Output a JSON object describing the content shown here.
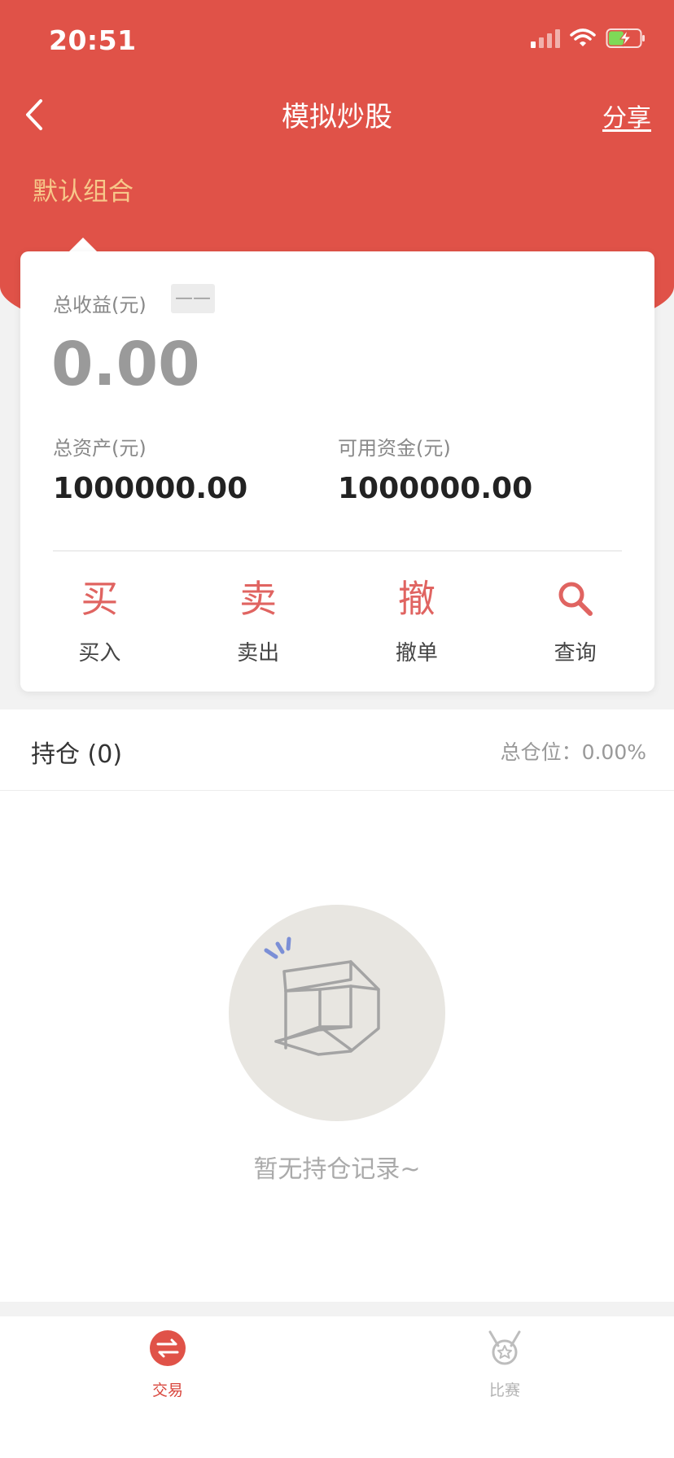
{
  "status_bar": {
    "time": "20:51"
  },
  "nav": {
    "title": "模拟炒股",
    "share_label": "分享"
  },
  "portfolio": {
    "tab_label": "默认组合"
  },
  "card": {
    "income_label": "总收益(元)",
    "income_badge": "——",
    "income_value": "0.00",
    "total_assets_label": "总资产(元)",
    "total_assets_value": "1000000.00",
    "available_funds_label": "可用资金(元)",
    "available_funds_value": "1000000.00"
  },
  "actions": [
    {
      "icon_char": "买",
      "label": "买入"
    },
    {
      "icon_char": "卖",
      "label": "卖出"
    },
    {
      "icon_char": "撤",
      "label": "撤单"
    },
    {
      "icon": "search-icon",
      "label": "查询"
    }
  ],
  "holdings": {
    "title": "持仓 (0)",
    "position_text": "总仓位：0.00%",
    "empty_text": "暂无持仓记录~"
  },
  "tab_bar": {
    "items": [
      {
        "label": "交易",
        "icon": "exchange-icon",
        "active": true
      },
      {
        "label": "比赛",
        "icon": "medal-icon",
        "active": false
      }
    ]
  },
  "colors": {
    "primary_red": "#e05248",
    "accent_orange": "#f7c88a",
    "action_red": "#e06461"
  }
}
